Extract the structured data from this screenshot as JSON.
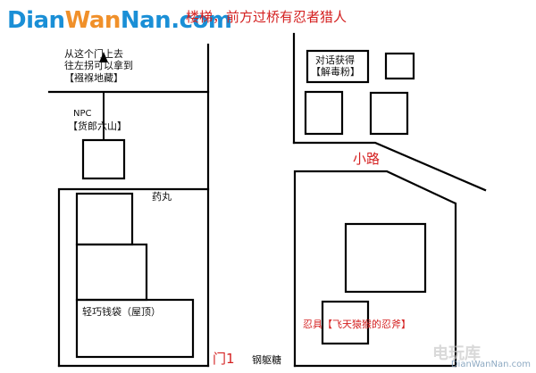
{
  "logo": {
    "part1": "Dian",
    "part2": "Wan",
    "part3": "Nan",
    "suffix": ".com"
  },
  "title": "楼梯，前方过桥有忍者猎人",
  "labels": {
    "hint_line1": "从这个门上去",
    "hint_line2": "往左拐可以拿到",
    "hint_line3": "【襁褓地藏】",
    "npc_line1": "NPC",
    "npc_line2": "【货郎六山】",
    "dialog_line1": "对话获得",
    "dialog_line2": "【解毒粉】",
    "path": "小路",
    "pill": "药丸",
    "purse": "轻巧钱袋（屋顶）",
    "gate": "门1",
    "candy": "钢躯糖",
    "ninja_tool": "忍具【飞天猿猴的忍斧】"
  },
  "watermark": {
    "site": "DianWanNan.com",
    "brand": "电玩库"
  },
  "colors": {
    "red": "#d42020",
    "line": "#000000",
    "logo_blue": "#1a8fd6",
    "logo_orange": "#f0902a"
  }
}
